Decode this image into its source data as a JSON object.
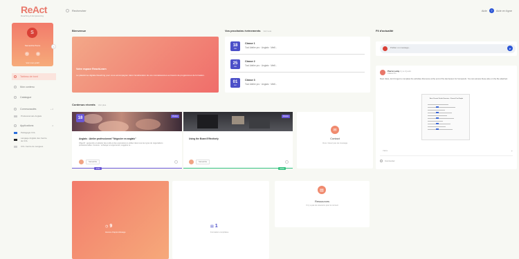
{
  "header": {
    "logo_main": "ReAct",
    "logo_sub": "Reaching & Empowering",
    "search_placeholder": "Rechercher",
    "help_label": "Aide",
    "lang_label": "Aide en ligne"
  },
  "profile": {
    "initial": "S",
    "name": "Samantha Pierre",
    "link_label": "Voir mon profil",
    "collapse_glyph": "<"
  },
  "sidebar": {
    "items": [
      {
        "label": "Tableau de bord",
        "active": true
      },
      {
        "label": "Mon contenu",
        "active": false
      },
      {
        "label": "Catalogue",
        "active": false
      }
    ],
    "communities": {
      "label": "Communautés",
      "tag": "+ 2"
    },
    "communities_sub": "Professionnels Anglais",
    "apps": {
      "label": "Applications",
      "tag": "2"
    },
    "apps_sub": [
      {
        "label": "Pédagogie CCL",
        "flag": "#2b6fdc"
      },
      {
        "label": "Langage Anglais des Centre de CCL",
        "flag": "#222222"
      },
      {
        "label": "CCL Centre de Langues",
        "flag": "#cccccc"
      }
    ]
  },
  "welcome": {
    "section": "Bienvenue",
    "title": "Votre espace ReachLearn",
    "text": "La plateforme digitale Reaching pour vous accompagner dans l'amélioration de vos connaissances au travers de programmes de formation."
  },
  "courses": {
    "section": "Vos prochains événements",
    "see_all": "Voir tous",
    "items": [
      {
        "day": "18",
        "month": "mar",
        "title": "Classe 1",
        "sub": "Tout Atelier pro · Anglais · Meill..."
      },
      {
        "day": "25",
        "month": "mar",
        "title": "Classe 2",
        "sub": "Tout Atelier pro · Anglais · Meill..."
      },
      {
        "day": "01",
        "month": "avr",
        "title": "Classe 3",
        "sub": "Tout Atelier pro · Anglais · Meill..."
      }
    ]
  },
  "recent": {
    "section": "Contenus récents",
    "see_all": "Voir plus",
    "items": [
      {
        "tag": "Module",
        "title": "Anglais : Atelier professionnel \"Négocier en anglais\"",
        "desc": "Objectif : apprendre et adopter des outils et des expressions à utiliser dans tous les types de négociations professionnelles. Contenu : échanger et argumenter, suggérer et...",
        "author": "Samantha",
        "progress": "17%",
        "progress_color": "#6a57d6"
      },
      {
        "tag": "Module",
        "title": "Using the Board Effectively",
        "desc": "",
        "author": "Samantha",
        "progress": "100%",
        "progress_color": "#33c27f"
      }
    ]
  },
  "contact": {
    "title": "Contact",
    "sub": "Vous n'avez pas de message",
    "icon": "mail-icon"
  },
  "stats": [
    {
      "value": "9",
      "label": "Heures d'apprentissage"
    },
    {
      "value": "1",
      "label": "Formation complétée"
    }
  ],
  "resources": {
    "title": "Ressources",
    "sub": "Il n'y a pas de ressource pour le moment",
    "icon": "document-icon"
  },
  "feed": {
    "section": "Fil d'actualité",
    "input_placeholder": "Publier un message...",
    "post": {
      "author": "Pierre Lamy",
      "author_meta": "il y a 2 jours",
      "group": "Classe Pro",
      "text": "Dear class, don't forget to complete the activities that were at the end of the last lesson for homework. You can access these also on the file attached.",
      "doc_title": "Basic Present Perfect Exercises - Present Past Simple",
      "reactions": "J'aime",
      "comments_label": "Commenter"
    }
  },
  "colors": {
    "accent": "#e8776a",
    "purple": "#4b4fc8",
    "green": "#33c27f",
    "blue": "#2c56d6"
  }
}
